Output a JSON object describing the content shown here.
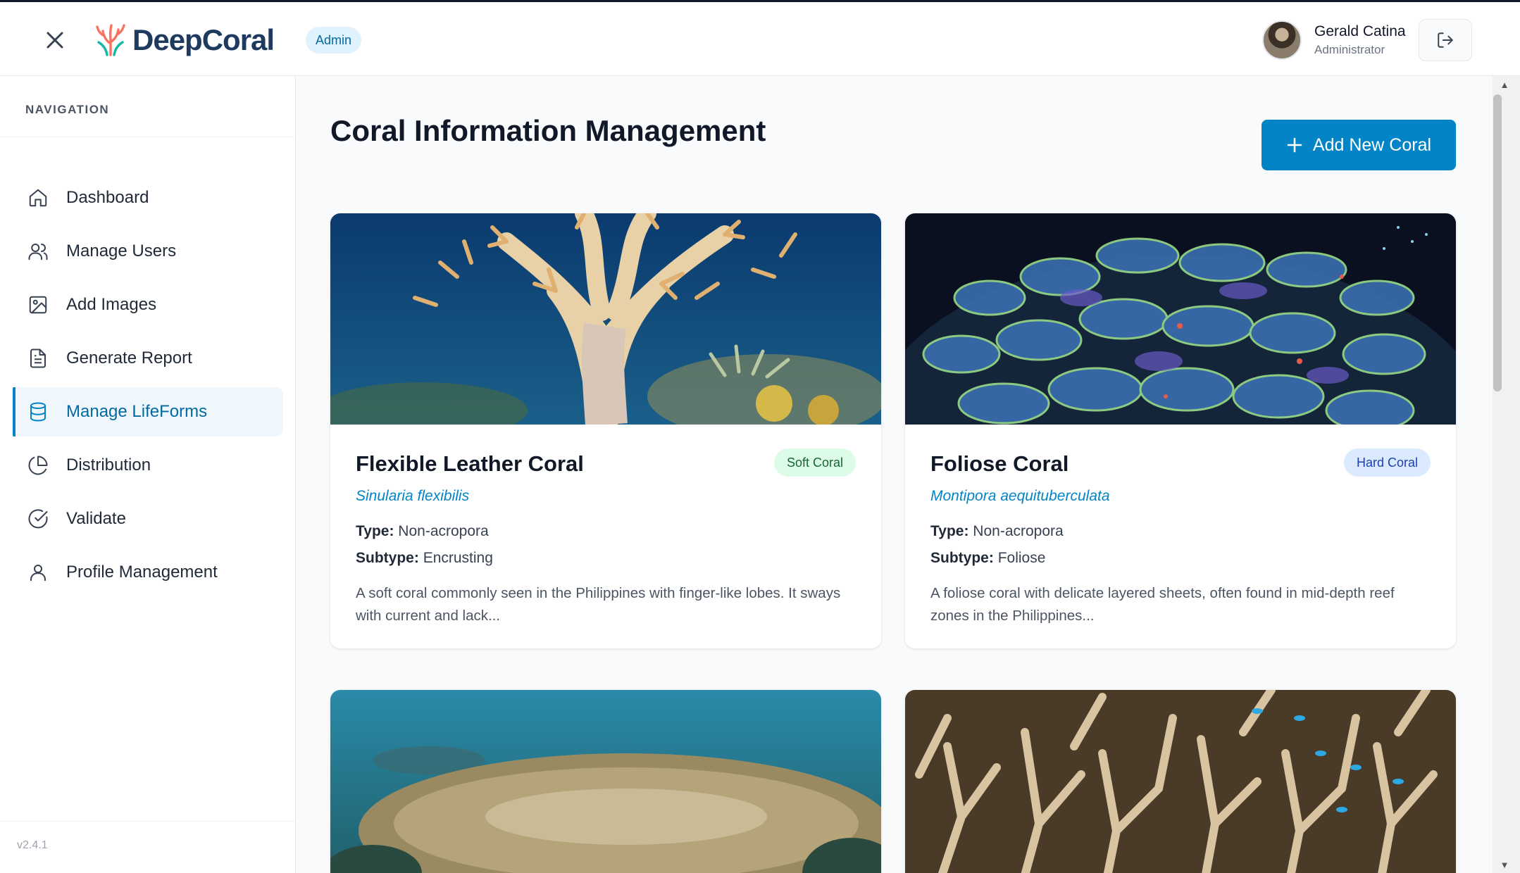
{
  "header": {
    "app_name": "DeepCoral",
    "role_badge": "Admin",
    "user": {
      "name": "Gerald Catina",
      "role": "Administrator"
    }
  },
  "sidebar": {
    "heading": "NAVIGATION",
    "items": [
      {
        "label": "Dashboard",
        "icon": "home-icon",
        "active": false
      },
      {
        "label": "Manage Users",
        "icon": "users-icon",
        "active": false
      },
      {
        "label": "Add Images",
        "icon": "image-icon",
        "active": false
      },
      {
        "label": "Generate Report",
        "icon": "document-icon",
        "active": false
      },
      {
        "label": "Manage LifeForms",
        "icon": "database-icon",
        "active": true
      },
      {
        "label": "Distribution",
        "icon": "pie-chart-icon",
        "active": false
      },
      {
        "label": "Validate",
        "icon": "check-circle-icon",
        "active": false
      },
      {
        "label": "Profile Management",
        "icon": "user-icon",
        "active": false
      }
    ],
    "version": "v2.4.1"
  },
  "main": {
    "title": "Coral Information Management",
    "add_button": "Add New Coral",
    "cards": [
      {
        "name": "Flexible Leather Coral",
        "badge": "Soft Coral",
        "scientific": "Sinularia flexibilis",
        "type_label": "Type:",
        "type": "Non-acropora",
        "subtype_label": "Subtype:",
        "subtype": "Encrusting",
        "description": "A soft coral commonly seen in the Philippines with finger-like lobes. It sways with current and lack..."
      },
      {
        "name": "Foliose Coral",
        "badge": "Hard Coral",
        "scientific": "Montipora aequituberculata",
        "type_label": "Type:",
        "type": "Non-acropora",
        "subtype_label": "Subtype:",
        "subtype": "Foliose",
        "description": "A foliose coral with delicate layered sheets, often found in mid-depth reef zones in the Philippines..."
      }
    ]
  },
  "colors": {
    "accent": "#0284c7",
    "brand_text": "#1e3a5f",
    "soft_badge_bg": "#dcfce7",
    "hard_badge_bg": "#dbeafe"
  }
}
